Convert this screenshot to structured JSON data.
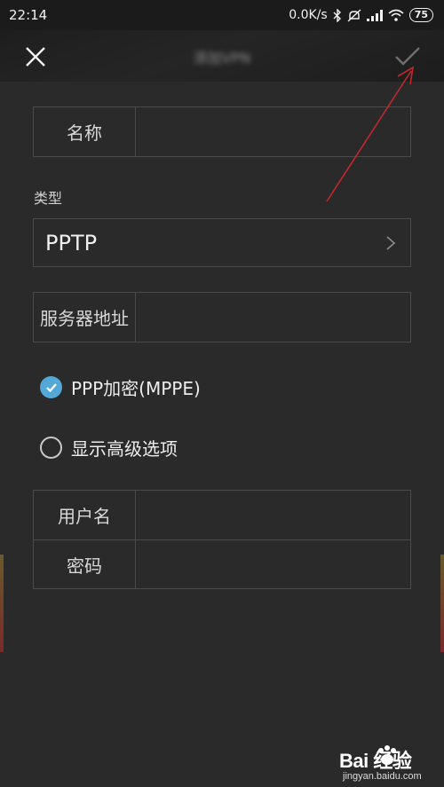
{
  "status_bar": {
    "time": "22:14",
    "net_speed": "0.0K/s",
    "battery": "75",
    "icons": [
      "bluetooth-icon",
      "mute-icon",
      "signal-icon",
      "wifi-icon",
      "battery-icon"
    ]
  },
  "header": {
    "title": "添加VPN",
    "close_icon": "close-icon",
    "confirm_icon": "checkmark-icon"
  },
  "form": {
    "name_label": "名称",
    "name_value": "",
    "type_label": "类型",
    "type_value": "PPTP",
    "server_label": "服务器地址",
    "server_value": "",
    "ppp_encryption_label": "PPP加密(MPPE)",
    "ppp_encryption_checked": true,
    "show_advanced_label": "显示高级选项",
    "show_advanced_checked": false,
    "username_label": "用户名",
    "username_value": "",
    "password_label": "密码",
    "password_value": ""
  },
  "annotation": {
    "arrow_color": "#c0282d"
  },
  "watermark": {
    "brand": "Bai 经验",
    "sub": "jingyan.baidu.com"
  },
  "colors": {
    "background": "#2a2a2a",
    "accent": "#54a8d8",
    "border": "#4a4a4a"
  }
}
